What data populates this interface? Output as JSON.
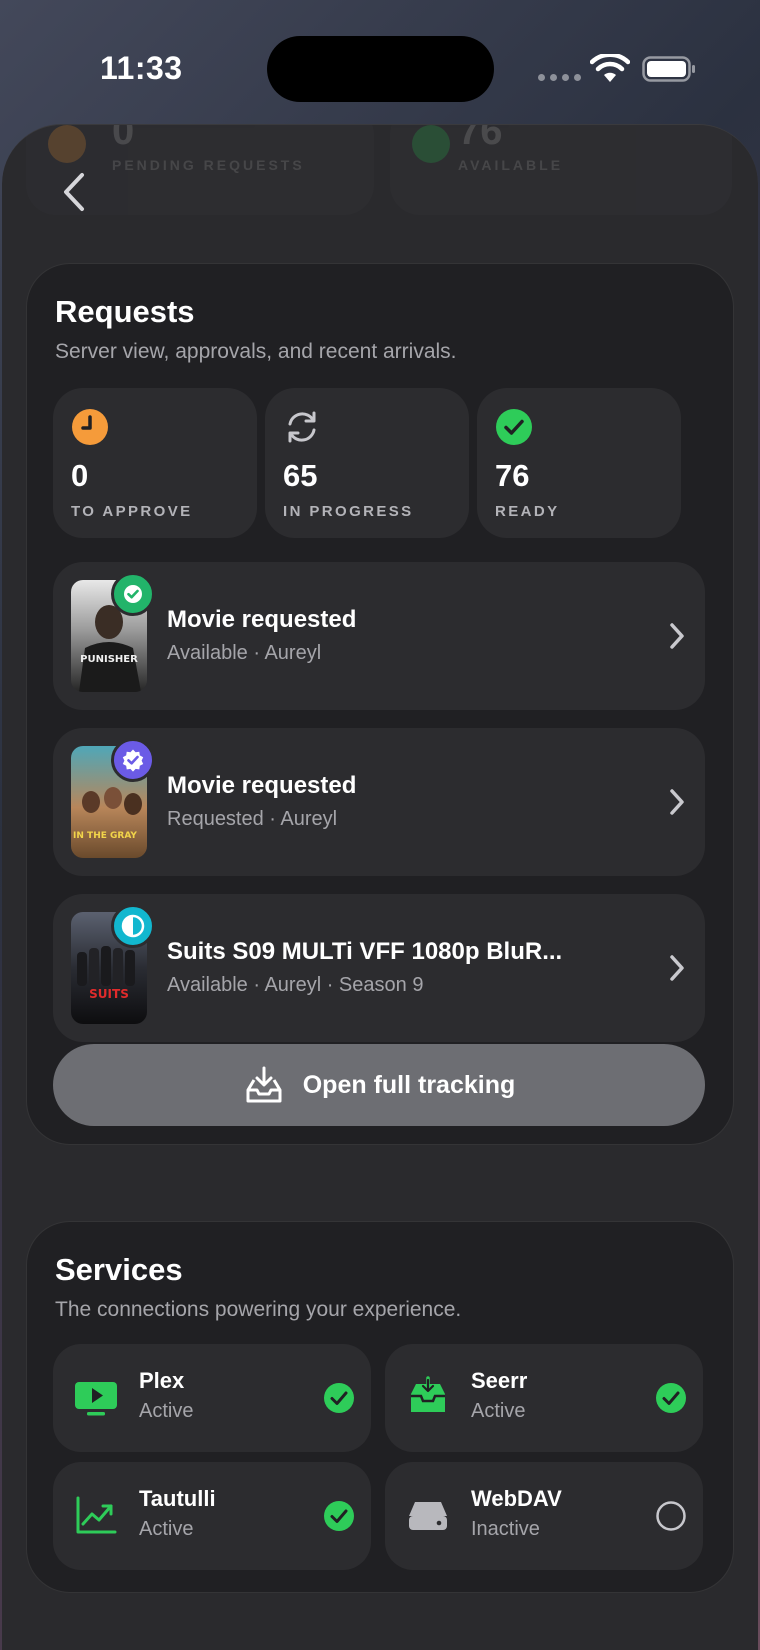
{
  "status_bar": {
    "time": "11:33"
  },
  "background_stats": [
    {
      "value": "0",
      "label": "PENDING REQUESTS",
      "color": "#f59b3a"
    },
    {
      "value": "76",
      "label": "AVAILABLE",
      "color": "#2ecc59"
    }
  ],
  "requests": {
    "title": "Requests",
    "subtitle": "Server view, approvals, and recent arrivals.",
    "stats": [
      {
        "value": "0",
        "label": "TO APPROVE",
        "icon": "clock-icon",
        "color": "#f59b3a"
      },
      {
        "value": "65",
        "label": "IN PROGRESS",
        "icon": "sync-icon",
        "color": "#c7c7cc"
      },
      {
        "value": "76",
        "label": "READY",
        "icon": "checkmark-circle-icon",
        "color": "#2ecc59"
      }
    ],
    "items": [
      {
        "title": "Movie requested",
        "meta": "Available · Aureyl",
        "badge_icon": "checkmark-icon",
        "badge_color": "#22b46a",
        "poster_text": "PUNISHER"
      },
      {
        "title": "Movie requested",
        "meta": "Requested · Aureyl",
        "badge_icon": "verified-seal-icon",
        "badge_color": "#6b5be6",
        "poster_text": "IN THE GRAY"
      },
      {
        "title": "Suits S09 MULTi VFF 1080p BluR...",
        "meta": "Available · Aureyl · Season 9",
        "badge_icon": "half-circle-icon",
        "badge_color": "#12b7cf",
        "poster_text": "SUITS"
      }
    ],
    "open_button_label": "Open full tracking"
  },
  "services": {
    "title": "Services",
    "subtitle": "The connections powering your experience.",
    "items": [
      {
        "name": "Plex",
        "state": "Active",
        "icon": "tv-play-icon",
        "active": true
      },
      {
        "name": "Seerr",
        "state": "Active",
        "icon": "inbox-download-icon",
        "active": true
      },
      {
        "name": "Tautulli",
        "state": "Active",
        "icon": "chart-trend-icon",
        "active": true
      },
      {
        "name": "WebDAV",
        "state": "Inactive",
        "icon": "server-drive-icon",
        "active": false
      }
    ],
    "active_color": "#2ecc59"
  }
}
